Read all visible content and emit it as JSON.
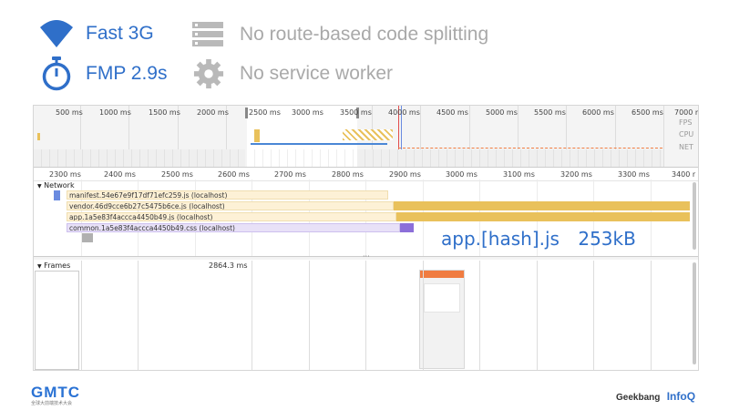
{
  "stats": {
    "network": {
      "icon": "wifi-icon",
      "label": "Fast 3G"
    },
    "fmp": {
      "icon": "stopwatch-icon",
      "label": "FMP 2.9s"
    },
    "splitting": {
      "icon": "server-icon",
      "label": "No route-based code splitting"
    },
    "worker": {
      "icon": "gear-icon",
      "label": "No service worker"
    }
  },
  "devtools": {
    "overview_ticks": [
      "500 ms",
      "1000 ms",
      "1500 ms",
      "2000 ms",
      "2500 ms",
      "3000 ms",
      "3500 ms",
      "4000 ms",
      "4500 ms",
      "5000 ms",
      "5500 ms",
      "6000 ms",
      "6500 ms",
      "7000 m"
    ],
    "overview_labels": {
      "fps": "FPS",
      "cpu": "CPU",
      "net": "NET"
    },
    "ruler_ticks": [
      "2300 ms",
      "2400 ms",
      "2500 ms",
      "2600 ms",
      "2700 ms",
      "2800 ms",
      "2900 ms",
      "3000 ms",
      "3100 ms",
      "3200 ms",
      "3300 ms",
      "3400 r"
    ],
    "network_label": "Network",
    "requests": [
      {
        "name": "manifest.54e67e9f17df71efc259.js (localhost)",
        "color": "#fbeccc"
      },
      {
        "name": "vendor.46d9cce6b27c5475b6ce.js (localhost)",
        "color": "#e9c15b"
      },
      {
        "name": "app.1a5e83f4accca4450b49.js (localhost)",
        "color": "#e9c15b"
      },
      {
        "name": "common.1a5e83f4accca4450b49.css (localhost)",
        "color": "#8c6fd9"
      }
    ],
    "annotation": {
      "file": "app.[hash].js",
      "size": "253kB"
    },
    "frames_label": "Frames",
    "frame_time": "2864.3 ms",
    "colors": {
      "accent": "#2f6fc9",
      "script": "#e9c15b",
      "style": "#8c6fd9",
      "frame_header": "#f07c41"
    }
  },
  "footer": {
    "left_logo": "GMTC",
    "left_sub": "全球大前端技术大会",
    "right_logo1": "Geekbang",
    "right_logo2": "InfoQ"
  }
}
